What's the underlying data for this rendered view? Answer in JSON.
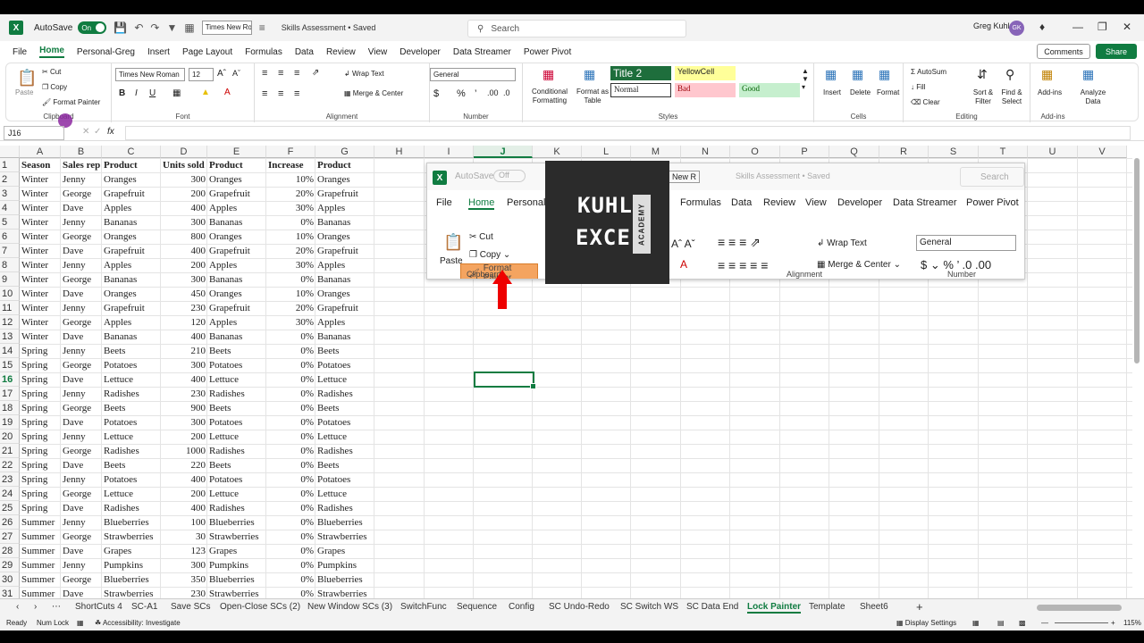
{
  "titlebar": {
    "autosave_label": "AutoSave",
    "autosave_state": "On",
    "font_name": "Times New Ro",
    "doc_title": "Skills Assessment • Saved",
    "search_placeholder": "Search",
    "user_name": "Greg Kuhl",
    "user_initials": "GK"
  },
  "menu_tabs": [
    "File",
    "Home",
    "Personal-Greg",
    "Insert",
    "Page Layout",
    "Formulas",
    "Data",
    "Review",
    "View",
    "Developer",
    "Data Streamer",
    "Power Pivot"
  ],
  "active_tab": "Home",
  "buttons": {
    "comments": "Comments",
    "share": "Share"
  },
  "ribbon": {
    "clipboard": {
      "paste": "Paste",
      "cut": "Cut",
      "copy": "Copy",
      "format_painter": "Format Painter",
      "label": "Clipboard"
    },
    "font": {
      "name": "Times New Roman",
      "size": "12",
      "label": "Font"
    },
    "alignment": {
      "wrap": "Wrap Text",
      "merge": "Merge & Center",
      "label": "Alignment"
    },
    "number": {
      "format": "General",
      "label": "Number"
    },
    "styles": {
      "cond": "Conditional Formatting",
      "table": "Format as Table",
      "cells": [
        "Title 2",
        "YellowCell",
        "Normal",
        "Bad",
        "Good"
      ],
      "label": "Styles"
    },
    "cells": {
      "insert": "Insert",
      "delete": "Delete",
      "format": "Format",
      "label": "Cells"
    },
    "editing": {
      "autosum": "AutoSum",
      "fill": "Fill",
      "clear": "Clear",
      "sort": "Sort & Filter",
      "find": "Find & Select",
      "label": "Editing"
    },
    "addins": {
      "addins": "Add-ins",
      "analyze": "Analyze Data",
      "label": "Add-ins"
    }
  },
  "formula_bar": {
    "name_box": "J16",
    "fx": "fx"
  },
  "columns": [
    "A",
    "B",
    "C",
    "D",
    "E",
    "F",
    "G",
    "H",
    "I",
    "J",
    "K",
    "L",
    "M",
    "N",
    "O",
    "P",
    "Q",
    "R",
    "S",
    "T",
    "U",
    "V"
  ],
  "selected_column": "J",
  "selected_row": 16,
  "header_row": [
    "Season",
    "Sales rep",
    "Product",
    "Units sold",
    "Product",
    "Increase",
    "Product"
  ],
  "rows": [
    [
      "Winter",
      "Jenny",
      "Oranges",
      "300",
      "Oranges",
      "10%",
      "Oranges"
    ],
    [
      "Winter",
      "George",
      "Grapefruit",
      "200",
      "Grapefruit",
      "20%",
      "Grapefruit"
    ],
    [
      "Winter",
      "Dave",
      "Apples",
      "400",
      "Apples",
      "30%",
      "Apples"
    ],
    [
      "Winter",
      "Jenny",
      "Bananas",
      "300",
      "Bananas",
      "0%",
      "Bananas"
    ],
    [
      "Winter",
      "George",
      "Oranges",
      "800",
      "Oranges",
      "10%",
      "Oranges"
    ],
    [
      "Winter",
      "Dave",
      "Grapefruit",
      "400",
      "Grapefruit",
      "20%",
      "Grapefruit"
    ],
    [
      "Winter",
      "Jenny",
      "Apples",
      "200",
      "Apples",
      "30%",
      "Apples"
    ],
    [
      "Winter",
      "George",
      "Bananas",
      "300",
      "Bananas",
      "0%",
      "Bananas"
    ],
    [
      "Winter",
      "Dave",
      "Oranges",
      "450",
      "Oranges",
      "10%",
      "Oranges"
    ],
    [
      "Winter",
      "Jenny",
      "Grapefruit",
      "230",
      "Grapefruit",
      "20%",
      "Grapefruit"
    ],
    [
      "Winter",
      "George",
      "Apples",
      "120",
      "Apples",
      "30%",
      "Apples"
    ],
    [
      "Winter",
      "Dave",
      "Bananas",
      "400",
      "Bananas",
      "0%",
      "Bananas"
    ],
    [
      "Spring",
      "Jenny",
      "Beets",
      "210",
      "Beets",
      "0%",
      "Beets"
    ],
    [
      "Spring",
      "George",
      "Potatoes",
      "300",
      "Potatoes",
      "0%",
      "Potatoes"
    ],
    [
      "Spring",
      "Dave",
      "Lettuce",
      "400",
      "Lettuce",
      "0%",
      "Lettuce"
    ],
    [
      "Spring",
      "Jenny",
      "Radishes",
      "230",
      "Radishes",
      "0%",
      "Radishes"
    ],
    [
      "Spring",
      "George",
      "Beets",
      "900",
      "Beets",
      "0%",
      "Beets"
    ],
    [
      "Spring",
      "Dave",
      "Potatoes",
      "300",
      "Potatoes",
      "0%",
      "Potatoes"
    ],
    [
      "Spring",
      "Jenny",
      "Lettuce",
      "200",
      "Lettuce",
      "0%",
      "Lettuce"
    ],
    [
      "Spring",
      "George",
      "Radishes",
      "1000",
      "Radishes",
      "0%",
      "Radishes"
    ],
    [
      "Spring",
      "Dave",
      "Beets",
      "220",
      "Beets",
      "0%",
      "Beets"
    ],
    [
      "Spring",
      "Jenny",
      "Potatoes",
      "400",
      "Potatoes",
      "0%",
      "Potatoes"
    ],
    [
      "Spring",
      "George",
      "Lettuce",
      "200",
      "Lettuce",
      "0%",
      "Lettuce"
    ],
    [
      "Spring",
      "Dave",
      "Radishes",
      "400",
      "Radishes",
      "0%",
      "Radishes"
    ],
    [
      "Summer",
      "Jenny",
      "Blueberries",
      "100",
      "Blueberries",
      "0%",
      "Blueberries"
    ],
    [
      "Summer",
      "George",
      "Strawberries",
      "30",
      "Strawberries",
      "0%",
      "Strawberries"
    ],
    [
      "Summer",
      "Dave",
      "Grapes",
      "123",
      "Grapes",
      "0%",
      "Grapes"
    ],
    [
      "Summer",
      "Jenny",
      "Pumpkins",
      "300",
      "Pumpkins",
      "0%",
      "Pumpkins"
    ],
    [
      "Summer",
      "George",
      "Blueberries",
      "350",
      "Blueberries",
      "0%",
      "Blueberries"
    ],
    [
      "Summer",
      "Dave",
      "Strawberries",
      "230",
      "Strawberries",
      "0%",
      "Strawberries"
    ]
  ],
  "inset": {
    "autosave_label": "AutoSave",
    "toggle": "Off",
    "font": "New R",
    "title": "Skills Assessment • Saved",
    "search": "Search",
    "tabs": [
      "File",
      "Home",
      "Personal-G",
      "Formulas",
      "Data",
      "Review",
      "View",
      "Developer",
      "Data Streamer",
      "Power Pivot"
    ],
    "paste": "Paste",
    "cut": "Cut",
    "copy": "Copy",
    "format_painter": "Format Painter",
    "clipboard": "Clipboard",
    "wrap": "Wrap Text",
    "merge": "Merge & Center",
    "alignment": "Alignment",
    "general": "General",
    "number": "Number"
  },
  "logo": {
    "line1": "KUHL",
    "line2": "EXCEL",
    "side": "ACADEMY"
  },
  "sheet_tabs": [
    "ShortCuts 4",
    "SC-A1",
    "Save SCs",
    "Open-Close SCs (2)",
    "New Window SCs (3)",
    "SwitchFunc",
    "Sequence",
    "Config",
    "SC Undo-Redo",
    "SC Switch WS",
    "SC Data End",
    "Lock Painter",
    "Template",
    "Sheet6"
  ],
  "active_sheet": "Lock Painter",
  "status": {
    "ready": "Ready",
    "numlock": "Num Lock",
    "accessibility": "Accessibility: Investigate",
    "display": "Display Settings",
    "zoom": "115%"
  },
  "colors": {
    "accent": "#107c41",
    "format_painter_highlight": "#f4a460",
    "arrow": "#e00000"
  }
}
